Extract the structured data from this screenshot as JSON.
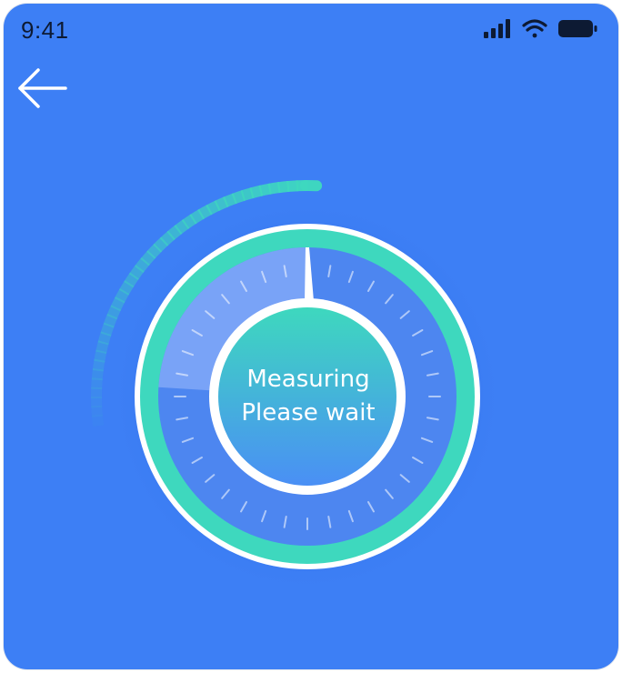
{
  "status_bar": {
    "time": "9:41",
    "icons": [
      "cellular-signal-icon",
      "wifi-icon",
      "battery-icon"
    ]
  },
  "nav": {
    "back_icon": "arrow-left-icon"
  },
  "gauge": {
    "status_line1": "Measuring",
    "status_line2": "Please wait",
    "progress_fraction": 0.24,
    "colors": {
      "background": "#3d7ff5",
      "ring_teal": "#3ed8be",
      "center_fill_top": "#3ed8be",
      "center_fill_bottom": "#4a8ff5",
      "ring_white": "#ffffff"
    }
  }
}
